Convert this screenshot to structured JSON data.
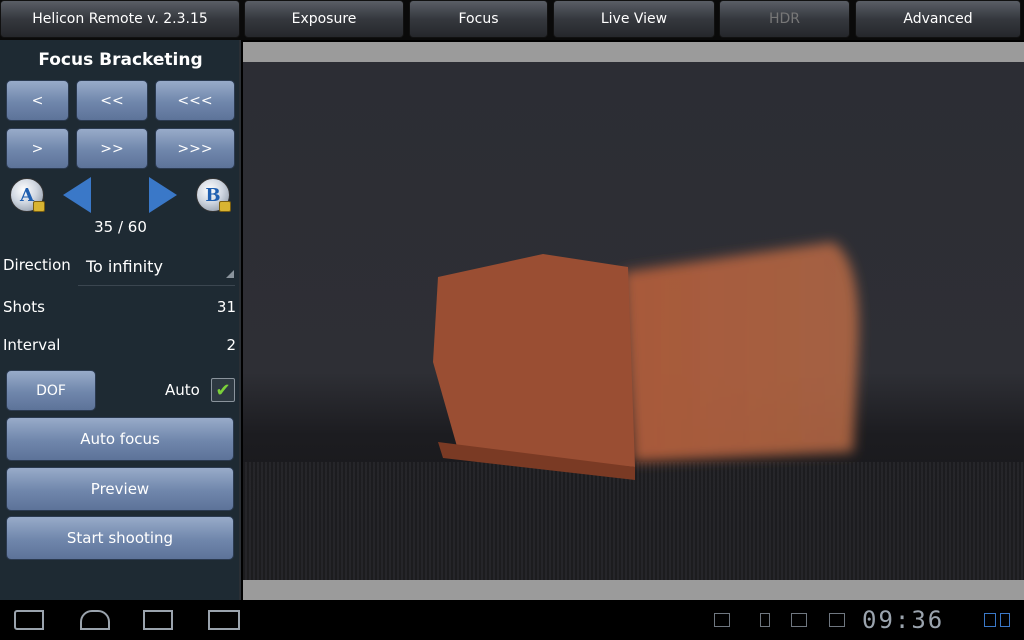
{
  "header": {
    "app_title": "Helicon Remote v. 2.3.15",
    "tabs": [
      {
        "label": "Exposure",
        "enabled": true
      },
      {
        "label": "Focus",
        "enabled": true
      },
      {
        "label": "Live View",
        "enabled": true
      },
      {
        "label": "HDR",
        "enabled": false
      },
      {
        "label": "Advanced",
        "enabled": true
      }
    ]
  },
  "panel": {
    "title": "Focus Bracketing",
    "step_back": [
      "<",
      "<<",
      "<<<"
    ],
    "step_forward": [
      ">",
      ">>",
      ">>>"
    ],
    "counter": "35 / 60",
    "direction_label": "Direction",
    "direction_value": "To infinity",
    "shots_label": "Shots",
    "shots_value": "31",
    "interval_label": "Interval",
    "interval_value": "2",
    "dof_label": "DOF",
    "auto_label": "Auto",
    "auto_checked": true,
    "autofocus_label": "Auto focus",
    "preview_label": "Preview",
    "start_label": "Start shooting",
    "point_a_icon": "A",
    "point_b_icon": "B"
  },
  "statusbar": {
    "time": "09:36"
  },
  "colors": {
    "accent_blue": "#3a78c8",
    "button_blue": "#6f86ab",
    "panel_bg": "#1e2a33",
    "check_green": "#7bd13a"
  }
}
